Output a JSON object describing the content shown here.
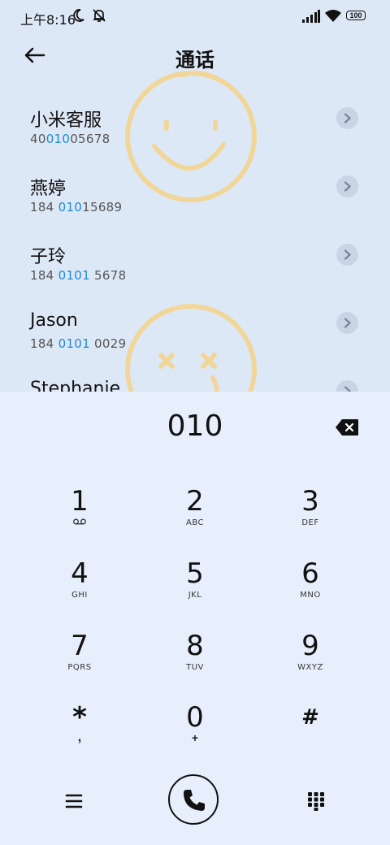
{
  "status_bar": {
    "time": "上午8:16",
    "battery": "100",
    "icons": [
      "moon-icon",
      "mute-icon",
      "signal-icon",
      "wifi-icon",
      "battery-icon"
    ]
  },
  "header": {
    "title": "通话"
  },
  "contacts": [
    {
      "name": "小米客服",
      "number_pre": "40",
      "number_hl": "010",
      "number_post": "05678"
    },
    {
      "name": "燕婷",
      "number_pre": "184 ",
      "number_hl": "010",
      "number_post": "15689"
    },
    {
      "name": "子玲",
      "number_pre": "184 ",
      "number_hl": "0101",
      "number_post": " 5678"
    },
    {
      "name": "Jason",
      "number_pre": "184 ",
      "number_hl": "0101",
      "number_post": " 0029"
    },
    {
      "name": "Stephanie",
      "number_pre": "",
      "number_hl": "",
      "number_post": ""
    }
  ],
  "dialer": {
    "input": "010",
    "keys": [
      {
        "digit": "1",
        "letters": ""
      },
      {
        "digit": "2",
        "letters": "ABC"
      },
      {
        "digit": "3",
        "letters": "DEF"
      },
      {
        "digit": "4",
        "letters": "GHI"
      },
      {
        "digit": "5",
        "letters": "JKL"
      },
      {
        "digit": "6",
        "letters": "MNO"
      },
      {
        "digit": "7",
        "letters": "PQRS"
      },
      {
        "digit": "8",
        "letters": "TUV"
      },
      {
        "digit": "9",
        "letters": "WXYZ"
      },
      {
        "digit": "*",
        "letters": ","
      },
      {
        "digit": "0",
        "letters": "+"
      },
      {
        "digit": "#",
        "letters": ""
      }
    ]
  },
  "colors": {
    "background": "#dde8f7",
    "dialer_background": "#e6effb",
    "highlight": "#1e8ad6",
    "watermark": "#f5d48a"
  }
}
